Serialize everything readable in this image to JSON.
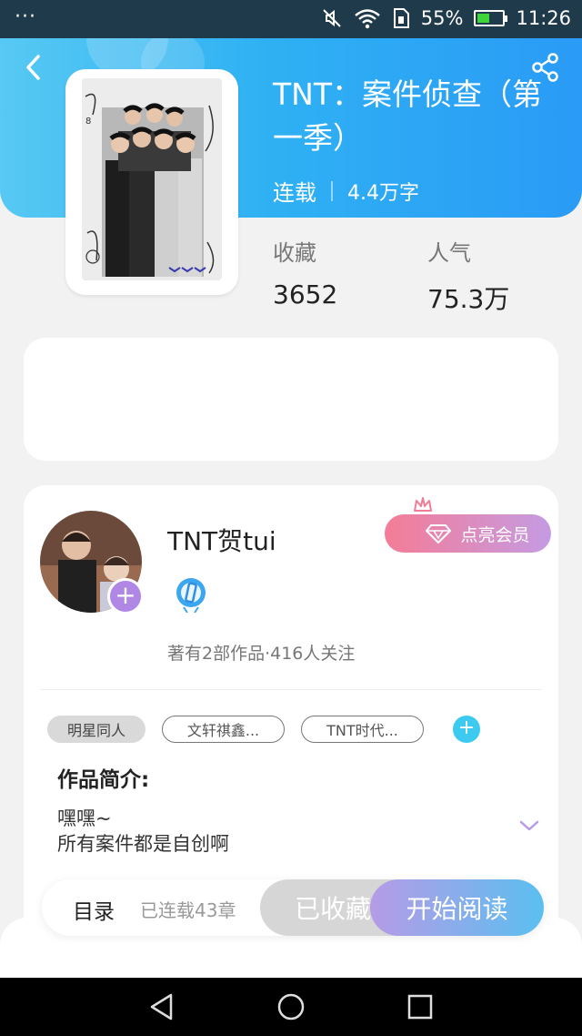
{
  "status_bar": {
    "dots": "···",
    "battery_percent": "55%",
    "battery_level": 0.55,
    "time": "11:26"
  },
  "book": {
    "title": "TNT：案件侦查（第一季）",
    "status": "连载",
    "word_count": "4.4万字",
    "stats": {
      "favorites_label": "收藏",
      "favorites_value": "3652",
      "popularity_label": "人气",
      "popularity_value": "75.3万"
    }
  },
  "author": {
    "name": "TNT贺tui",
    "vip_label": "点亮会员",
    "stats_text": "著有2部作品·416人关注"
  },
  "tags": [
    "明星同人",
    "文轩祺鑫...",
    "TNT时代..."
  ],
  "intro": {
    "heading": "作品简介:",
    "line1": "嘿嘿~",
    "line2": "所有案件都是自创啊"
  },
  "action_bar": {
    "toc_label": "目录",
    "chapters_text": "已连载43章",
    "collected_label": "已收藏",
    "read_label": "开始阅读"
  },
  "colors": {
    "header_start": "#57c9f3",
    "header_end": "#2a9bf6",
    "accent_purple": "#b187e6",
    "accent_cyan": "#3ccaf0"
  },
  "icons": [
    "back-arrow-icon",
    "share-icon",
    "plus-icon",
    "diamond-icon",
    "crown-icon",
    "author-badge-icon",
    "chevron-down-icon",
    "nav-back-icon",
    "nav-home-icon",
    "nav-recents-icon"
  ]
}
